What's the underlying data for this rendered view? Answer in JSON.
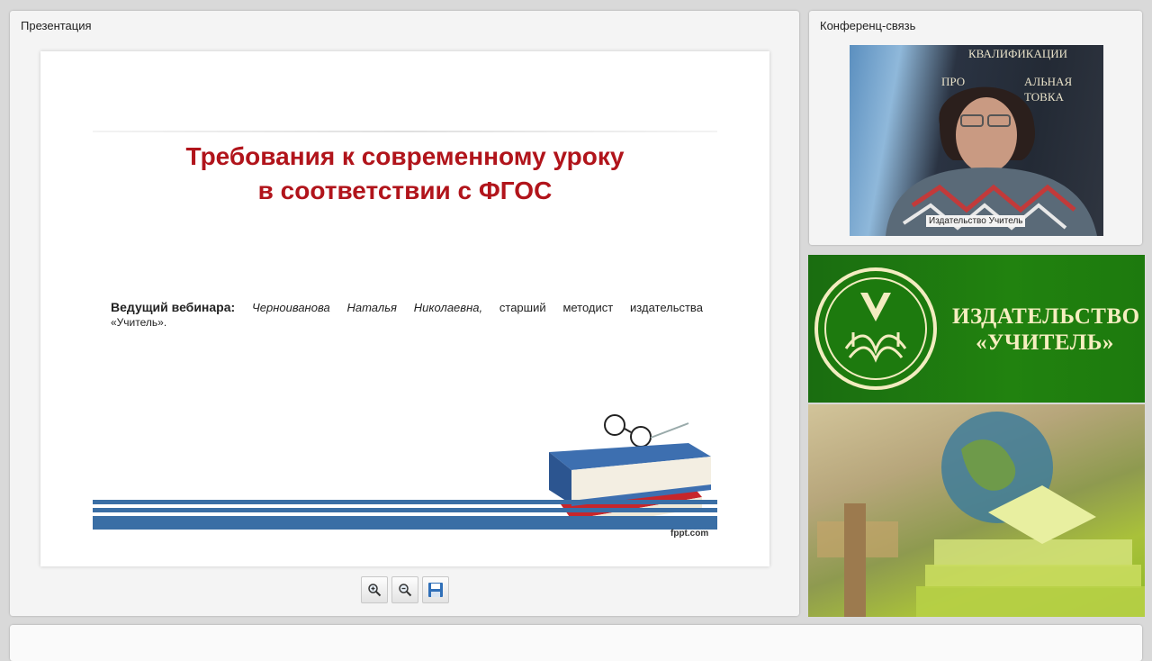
{
  "presentation": {
    "title": "Презентация",
    "slide": {
      "title_line1": "Требования к современному уроку",
      "title_line2": "в соответствии  с ФГОС",
      "presenter_label": "Ведущий вебинара:",
      "presenter_words": [
        "Черноиванова",
        "Наталья",
        "Николаевна,",
        "старший",
        "методист",
        "издательства"
      ],
      "presenter_line2": "«Учитель».",
      "watermark": "fppt.com"
    },
    "toolbar": {
      "zoom_in_icon": "zoom-in-icon",
      "zoom_out_icon": "zoom-out-icon",
      "save_icon": "save-icon"
    }
  },
  "conference": {
    "title": "Конференц-связь",
    "participant_label": "Издательство Учитель",
    "background_text": [
      "КВАЛИФИКАЦИИ",
      "ПРО",
      "АЛЬНАЯ",
      "ТОВКА"
    ]
  },
  "brand": {
    "name_line1": "ИЗДАТЕЛЬСТВО",
    "name_line2": "«УЧИТЕЛЬ»",
    "accent_green": "#21820f",
    "text_color": "#f6eec0"
  },
  "colors": {
    "slide_title": "#b1141b",
    "stripe_blue": "#3a6ea5"
  }
}
